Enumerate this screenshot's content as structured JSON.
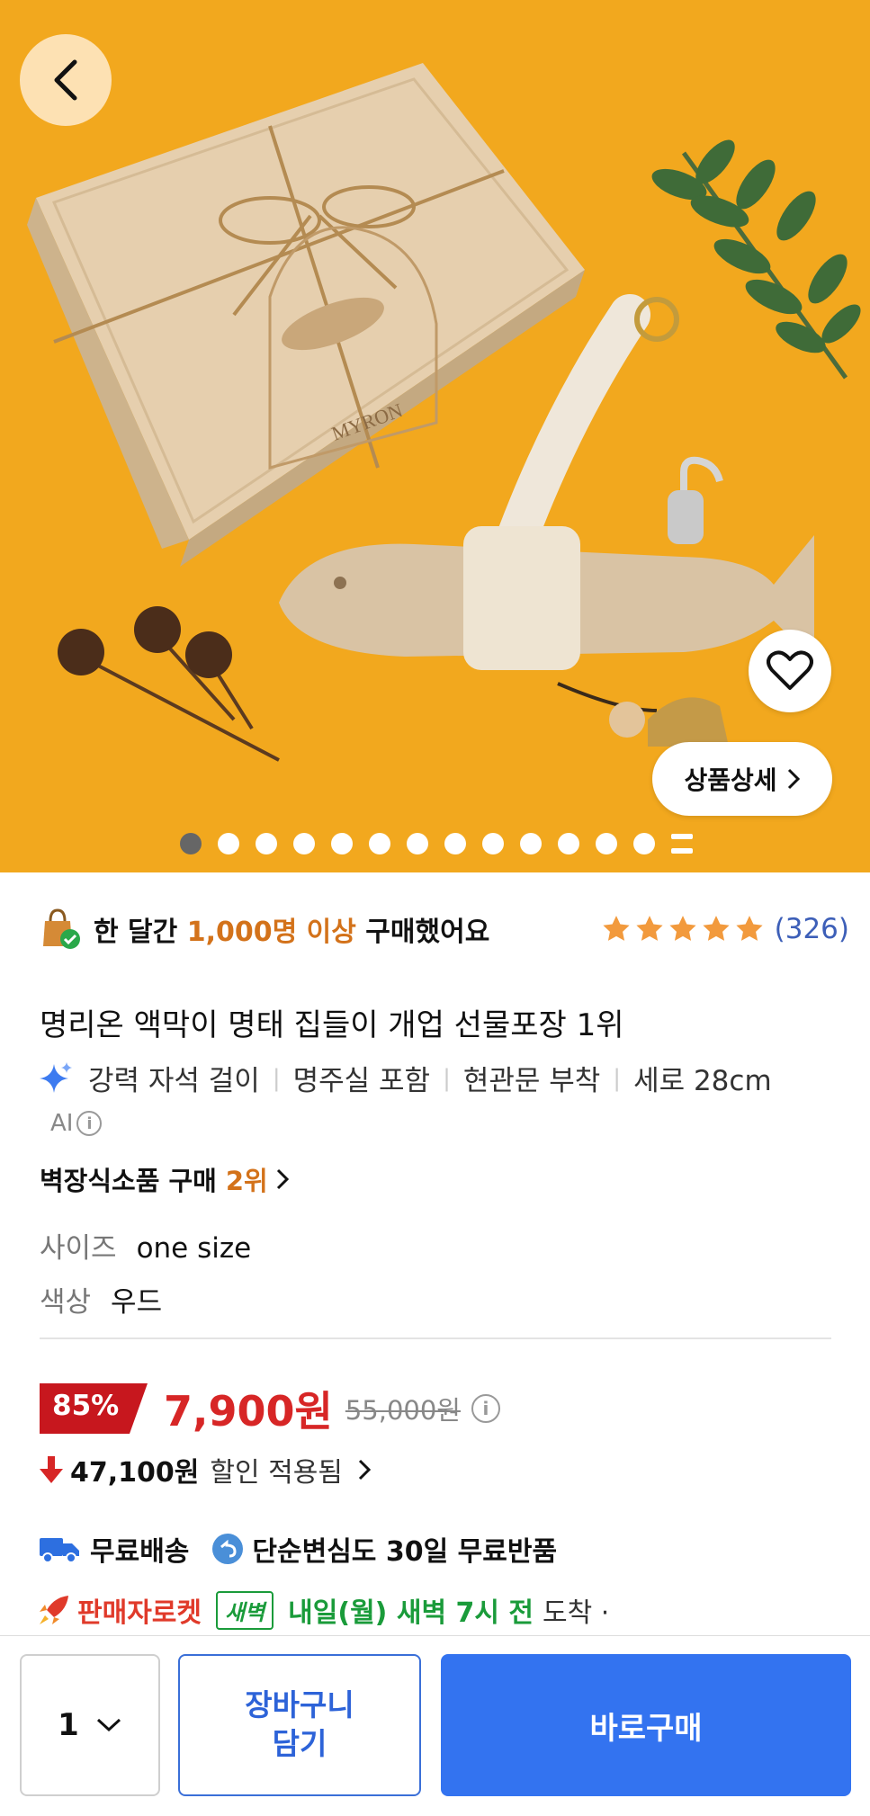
{
  "hero": {
    "box_brand": "MYRON",
    "detail_label": "상품상세",
    "dot_count": 13,
    "active_dot": 0
  },
  "social": {
    "prefix": "한 달간 ",
    "highlight": "1,000명 이상",
    "suffix": " 구매했어요",
    "rating_stars": 5,
    "review_count": "(326)"
  },
  "product": {
    "title": "명리온 액막이 명태 집들이 개업 선물포장 1위",
    "ai_features": [
      "강력 자석 걸이",
      "명주실 포함",
      "현관문 부착",
      "세로 28cm"
    ],
    "ai_label": "AI",
    "rank_text": "벽장식소품 구매",
    "rank_num": "2위",
    "options": [
      {
        "key": "사이즈",
        "value": "one size"
      },
      {
        "key": "색상",
        "value": "우드"
      }
    ]
  },
  "price": {
    "discount": "85%",
    "sale": "7,900원",
    "original": "55,000원",
    "saving_amount": "47,100원",
    "saving_label": "할인 적용됨"
  },
  "shipping": {
    "free_ship": "무료배송",
    "free_return": "단순변심도 30일 무료반품",
    "rocket": "판매자로켓",
    "dawn": "새벽",
    "arrival": "내일(월) 새벽 7시 전",
    "arrival_suffix": "도착 ·"
  },
  "bottom": {
    "qty": "1",
    "cart_line1": "장바구니",
    "cart_line2": "담기",
    "buy": "바로구매"
  },
  "colors": {
    "hero_bg": "#f2a81e",
    "accent_orange": "#d3721a",
    "price_red": "#d72626",
    "buy_blue": "#3373f0",
    "rocket_red": "#e03a2a",
    "dawn_green": "#1a9b3a"
  }
}
